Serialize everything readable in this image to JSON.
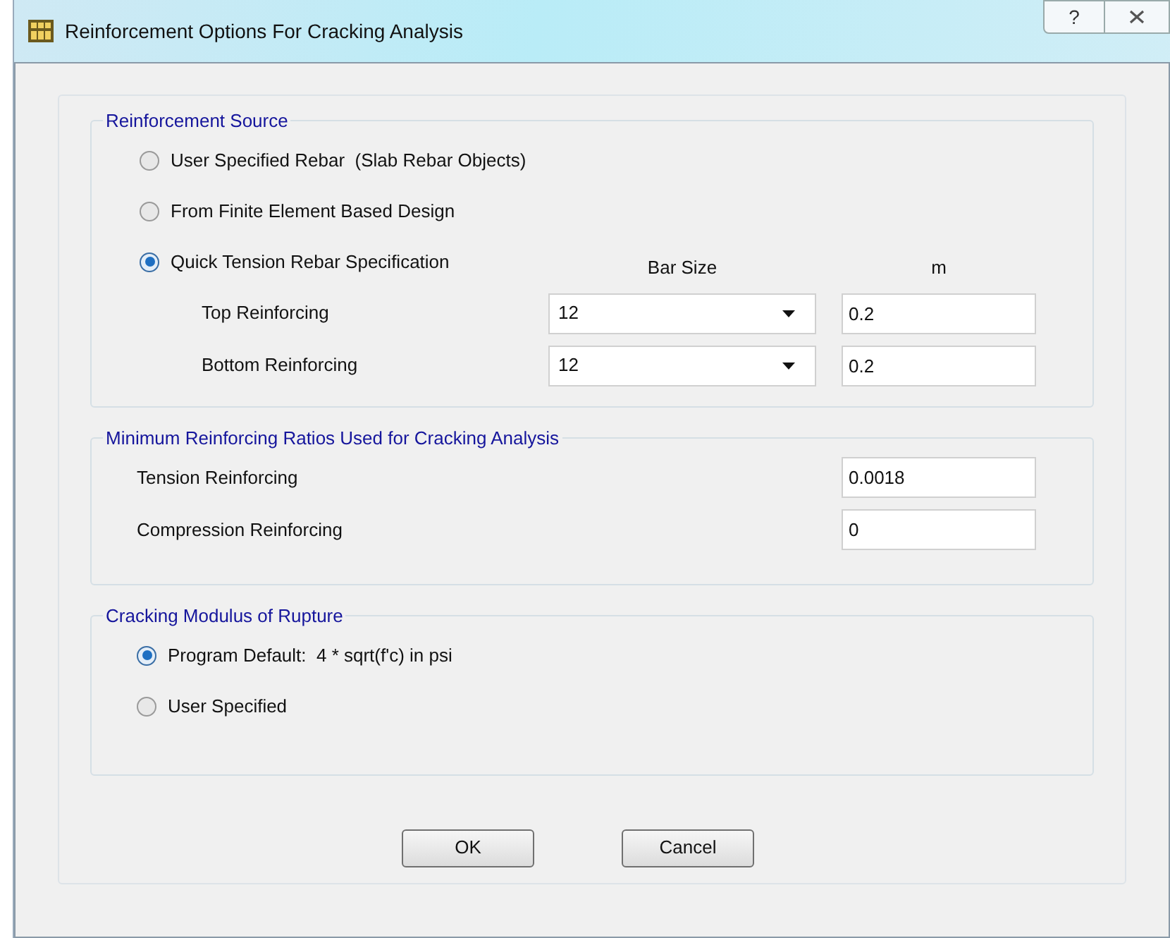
{
  "window": {
    "title": "Reinforcement Options For Cracking Analysis",
    "help_button": "?"
  },
  "reinforcement_source": {
    "title": "Reinforcement Source",
    "options": [
      {
        "label": "User Specified Rebar  (Slab Rebar Objects)",
        "selected": false
      },
      {
        "label": "From Finite Element Based Design",
        "selected": false
      },
      {
        "label": "Quick Tension Rebar Specification",
        "selected": true
      }
    ],
    "columns": [
      "Bar Size",
      "m"
    ],
    "rows": [
      {
        "label": "Top Reinforcing",
        "bar_size": "12",
        "spacing": "0.2"
      },
      {
        "label": "Bottom Reinforcing",
        "bar_size": "12",
        "spacing": "0.2"
      }
    ]
  },
  "minimum_ratios": {
    "title": "Minimum Reinforcing Ratios Used for Cracking Analysis",
    "rows": [
      {
        "label": "Tension Reinforcing",
        "value": "0.0018"
      },
      {
        "label": "Compression Reinforcing",
        "value": "0"
      }
    ]
  },
  "modulus_of_rupture": {
    "title": "Cracking Modulus of Rupture",
    "options": [
      {
        "label": "Program Default:  4 * sqrt(f'c) in psi",
        "selected": true
      },
      {
        "label": "User Specified",
        "selected": false
      }
    ]
  },
  "buttons": [
    "OK",
    "Cancel"
  ]
}
